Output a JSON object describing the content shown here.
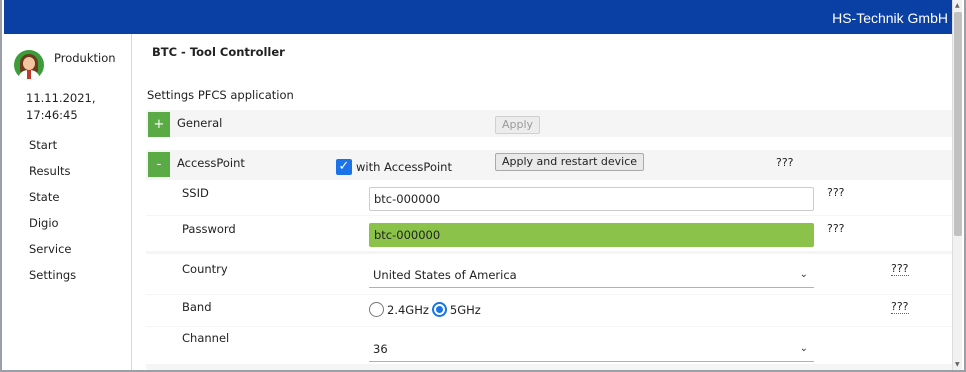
{
  "header": {
    "company": "HS-Technik GmbH"
  },
  "sidebar": {
    "user": "Produktion",
    "date": "11.11.2021,",
    "time": "17:46:45",
    "items": [
      {
        "label": "Start"
      },
      {
        "label": "Results"
      },
      {
        "label": "State"
      },
      {
        "label": "Digio"
      },
      {
        "label": "Service"
      },
      {
        "label": "Settings"
      }
    ]
  },
  "main": {
    "title": "BTC - Tool Controller",
    "section": "Settings PFCS application",
    "general": {
      "toggle": "+",
      "label": "General",
      "apply_label": "Apply"
    },
    "accesspoint": {
      "toggle": "-",
      "label": "AccessPoint",
      "checkbox_label": "with AccessPoint",
      "checkbox_checked": true,
      "apply_label": "Apply and restart device",
      "help": "???",
      "fields": {
        "ssid": {
          "label": "SSID",
          "value": "btc-000000",
          "help": "???"
        },
        "password": {
          "label": "Password",
          "value": "btc-000000",
          "help": "???"
        },
        "country": {
          "label": "Country",
          "value": "United States of America",
          "help": "???"
        },
        "band": {
          "label": "Band",
          "options": [
            "2.4GHz",
            "5GHz"
          ],
          "selected": "5GHz",
          "help": "???"
        },
        "channel": {
          "label": "Channel",
          "value": "36"
        }
      }
    }
  },
  "colors": {
    "header": "#0a3fa3",
    "accent_green": "#5aab45",
    "password_green": "#8bc34a",
    "checkbox_blue": "#1a73e8"
  },
  "icons": {
    "avatar": "user-avatar-icon",
    "check": "checkmark-icon",
    "chevron": "chevron-down-icon"
  }
}
